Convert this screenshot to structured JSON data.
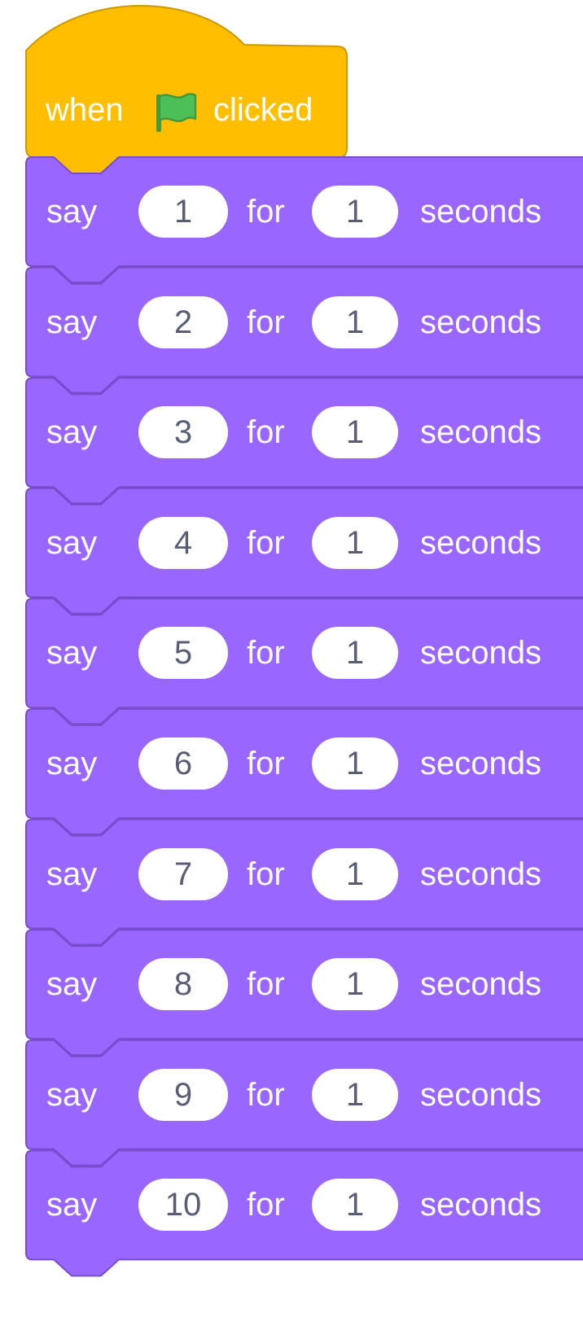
{
  "hat_block": {
    "prefix": "when",
    "suffix": "clicked",
    "icon": "green-flag-icon",
    "color": "#FFBF00",
    "border_color": "#CC9900"
  },
  "say_blocks": [
    {
      "verb": "say",
      "message": "1",
      "mid": "for",
      "secs": "1",
      "unit": "seconds"
    },
    {
      "verb": "say",
      "message": "2",
      "mid": "for",
      "secs": "1",
      "unit": "seconds"
    },
    {
      "verb": "say",
      "message": "3",
      "mid": "for",
      "secs": "1",
      "unit": "seconds"
    },
    {
      "verb": "say",
      "message": "4",
      "mid": "for",
      "secs": "1",
      "unit": "seconds"
    },
    {
      "verb": "say",
      "message": "5",
      "mid": "for",
      "secs": "1",
      "unit": "seconds"
    },
    {
      "verb": "say",
      "message": "6",
      "mid": "for",
      "secs": "1",
      "unit": "seconds"
    },
    {
      "verb": "say",
      "message": "7",
      "mid": "for",
      "secs": "1",
      "unit": "seconds"
    },
    {
      "verb": "say",
      "message": "8",
      "mid": "for",
      "secs": "1",
      "unit": "seconds"
    },
    {
      "verb": "say",
      "message": "9",
      "mid": "for",
      "secs": "1",
      "unit": "seconds"
    },
    {
      "verb": "say",
      "message": "10",
      "mid": "for",
      "secs": "1",
      "unit": "seconds"
    }
  ],
  "colors": {
    "looks_block": "#9966FF",
    "looks_border": "#774DCB",
    "input_text": "#575E75",
    "input_bg": "#FFFFFF",
    "flag_green": "#4CBF56"
  }
}
